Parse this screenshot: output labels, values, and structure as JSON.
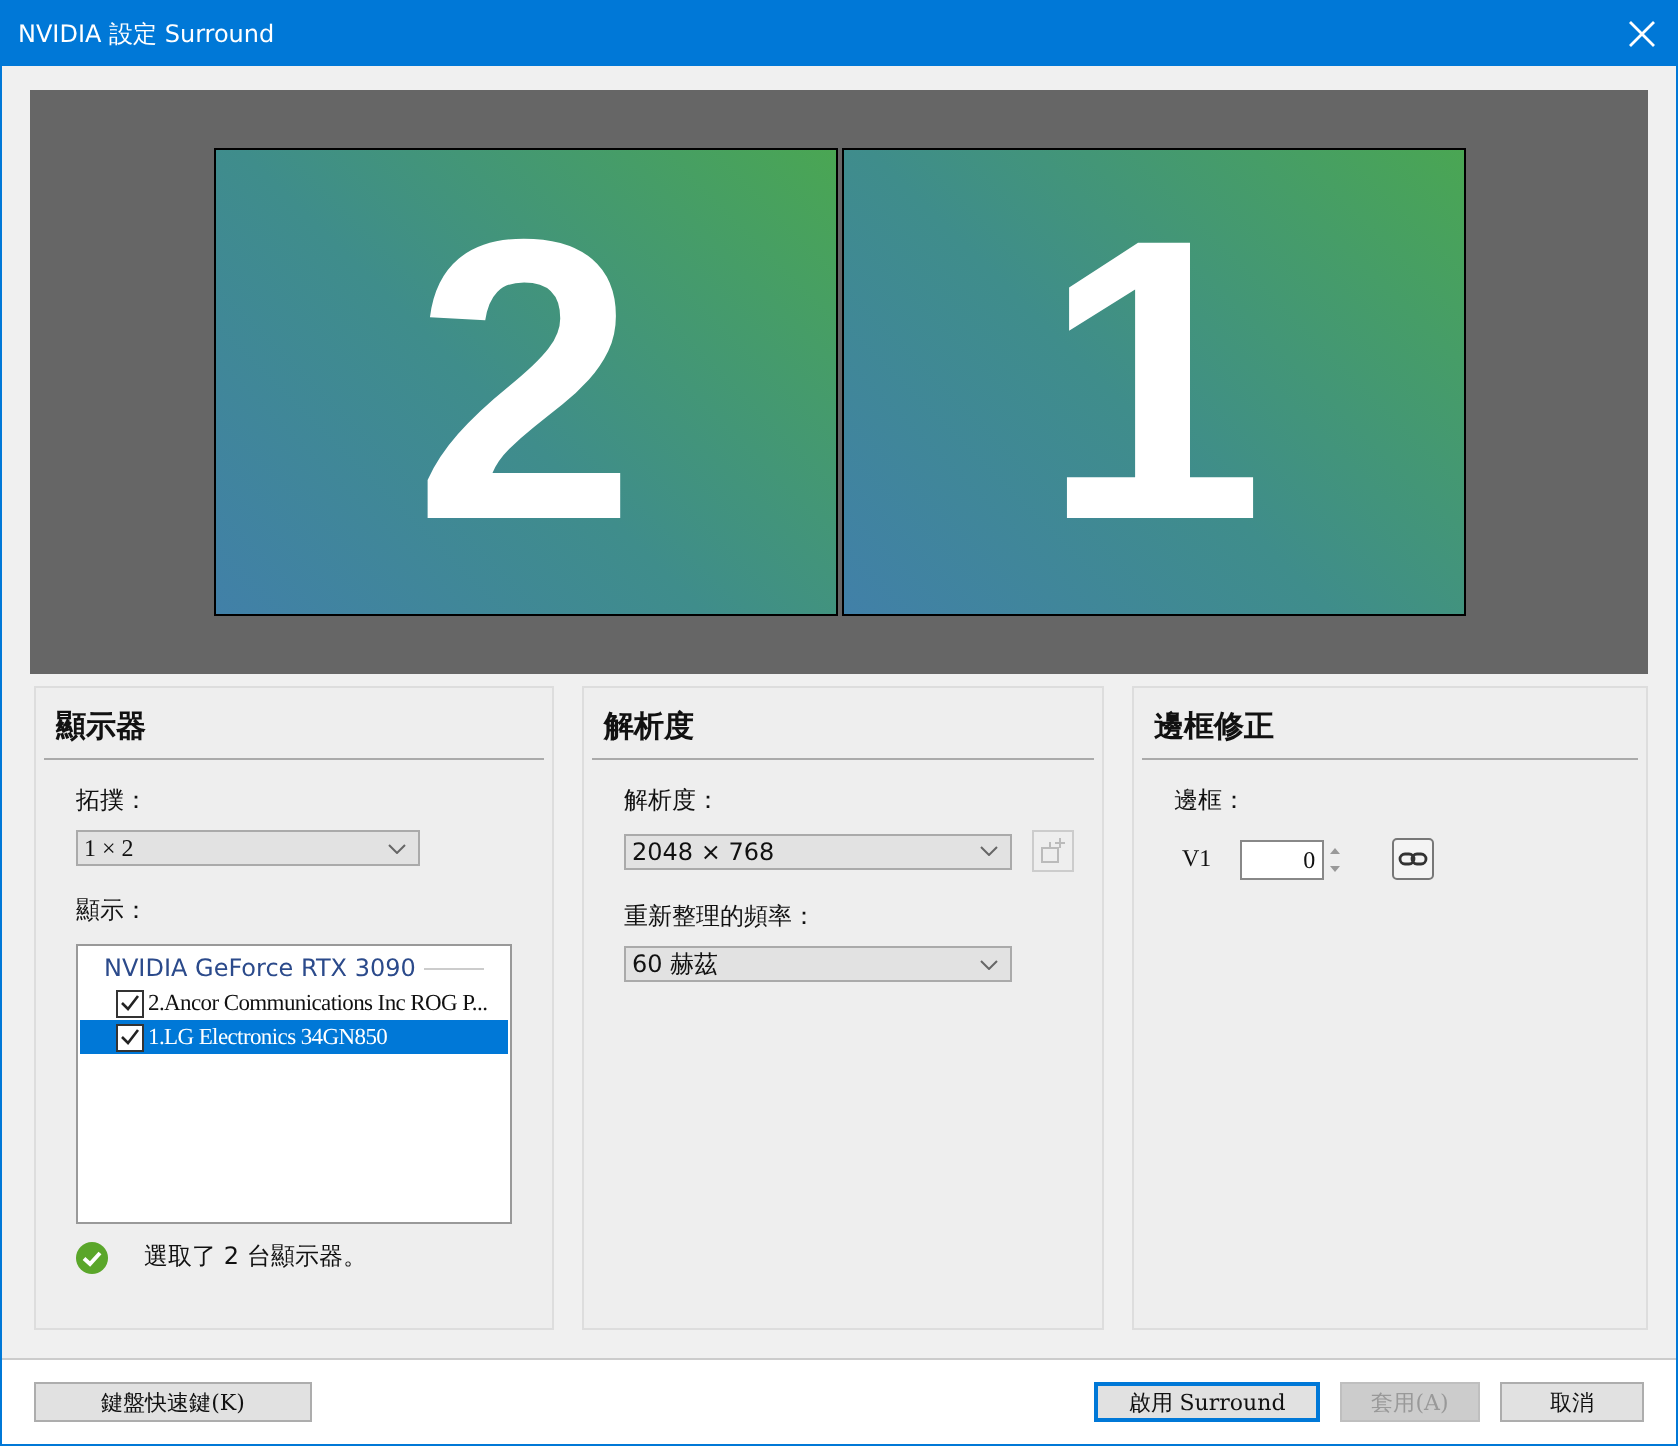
{
  "window": {
    "title": "NVIDIA 設定 Surround"
  },
  "preview": {
    "monitors": [
      {
        "number": "2"
      },
      {
        "number": "1"
      }
    ]
  },
  "displays_panel": {
    "heading": "顯示器",
    "topology_label": "拓撲：",
    "topology_value": "1 × 2",
    "display_label": "顯示：",
    "gpu": "NVIDIA GeForce RTX 3090",
    "items": [
      {
        "label": "2.Ancor Communications Inc ROG P...",
        "checked": true,
        "selected": false
      },
      {
        "label": "1.LG Electronics 34GN850",
        "checked": true,
        "selected": true
      }
    ],
    "status": "選取了 2 台顯示器。"
  },
  "resolution_panel": {
    "heading": "解析度",
    "resolution_label": "解析度：",
    "resolution_value": "2048 × 768",
    "refresh_label": "重新整理的頻率：",
    "refresh_value": "60  赫茲"
  },
  "bezel_panel": {
    "heading": "邊框修正",
    "bezel_label": "邊框：",
    "v1_label": "V1",
    "v1_value": "0"
  },
  "buttons": [
    {
      "label": "鍵盤快速鍵(K)",
      "disabled": false,
      "default": false
    },
    {
      "label": "啟用 Surround",
      "disabled": false,
      "default": true
    },
    {
      "label": "套用(A)",
      "disabled": true,
      "default": false
    },
    {
      "label": "取消",
      "disabled": false,
      "default": false
    }
  ]
}
